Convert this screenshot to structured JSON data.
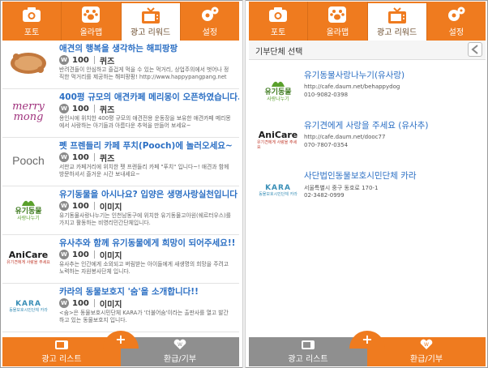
{
  "colors": {
    "accent": "#ef7b1f",
    "link": "#2b6fc4",
    "inactive_tab": "#8f8f8f"
  },
  "tabs": [
    {
      "label": "포토",
      "icon": "camera-icon"
    },
    {
      "label": "올라맵",
      "icon": "paw-icon"
    },
    {
      "label": "광고 리워드",
      "icon": "tv-icon"
    },
    {
      "label": "설정",
      "icon": "gear-icon"
    }
  ],
  "ads": [
    {
      "logo": "happypangpang-logo",
      "title": "애견의 행복을 생각하는 해피팡팡",
      "points": "100",
      "kind": "퀴즈",
      "desc": "반려견들이 안심하고 즐겁게 먹을 수 있는 먹거리, 상업주의에서 벗어나 정직한 먹거리를 제공하는 해피팡팡! http://www.happypangpang.net"
    },
    {
      "logo": "merrymong-logo",
      "logo_text_1": "merry",
      "logo_text_2": "mong",
      "title": "400평 규모의 애견카페 메리몽이 오픈하였습니다.",
      "points": "100",
      "kind": "퀴즈",
      "desc": "용인시에 위치한 400평 규모의 애견전용 운동장을 보유한 애견카페 메리몽에서 사랑하는 아기들과 아름다운 추억을 만들어 보세요~"
    },
    {
      "logo": "pooch-logo",
      "logo_text_1": "Pooch",
      "title": "펫 프렌들리 카페 푸치(Pooch)에 놀러오세요~",
      "points": "100",
      "kind": "퀴즈",
      "desc": "서판교 카페거리에 위치한 펫 프렌들리 카페 \"푸치\" 입니다~! 애견과 함께 방문하셔서 즐거운 시간 보내세요~"
    },
    {
      "logo": "behappy-logo",
      "logo_text_1": "유기동물",
      "logo_text_2": "사랑나누기",
      "title": "유기동물을 아시나요? 입양은 생명사랑실천입니다 !",
      "points": "100",
      "kind": "이미지",
      "desc": "유기동물사랑나누기는 인천남동구에 위치한 유기동물고아원(쉐르터우스)를 가지고 활동하는 비영리민간단체입니다."
    },
    {
      "logo": "anicare-logo",
      "logo_text_1": "AniCare",
      "logo_text_2": "유기견에게 사랑을 주세요",
      "title": "유사추와 함께 유기동물에게 희망이 되어주세요!!",
      "points": "100",
      "kind": "이미지",
      "desc": "유사추는 인간에게 소외되고 버림받는 아이들에게 새생명의 희망을 주려고 노력하는 자원봉사단체 입니다."
    },
    {
      "logo": "kara-logo",
      "logo_text_1": "KARA",
      "logo_text_2": "동물보호시민단체 카라",
      "title": "카라의 동물보호지 '숨'을 소개합니다!!",
      "points": "100",
      "kind": "이미지",
      "desc": "<숨>은 동물보호시민단체 KARA가 '더불어숨'이라는 출판사를 열고 발간하고 있는 동물보호지 입니다."
    }
  ],
  "bottom": {
    "left_label": "광고 리스트",
    "right_label": "환급/기부",
    "plus": "+"
  },
  "donate": {
    "title": "기부단체 선택",
    "orgs": [
      {
        "logo": "behappy-logo",
        "name": "유기동물사랑나누기(유사랑)",
        "line1": "http://cafe.daum.net/behappydog",
        "line2": "010-9082-0398"
      },
      {
        "logo": "anicare-logo",
        "name": "유기견에게 사랑을 주세요 (유사추)",
        "line1": "http://cafe.daum.net/dooc77",
        "line2": "070-7807-0354"
      },
      {
        "logo": "kara-logo",
        "name": "사단법인동물보호시민단체 카라",
        "line1": "서울특별시 중구 동호로 170-1",
        "line2": "02-3482-0999"
      }
    ]
  }
}
